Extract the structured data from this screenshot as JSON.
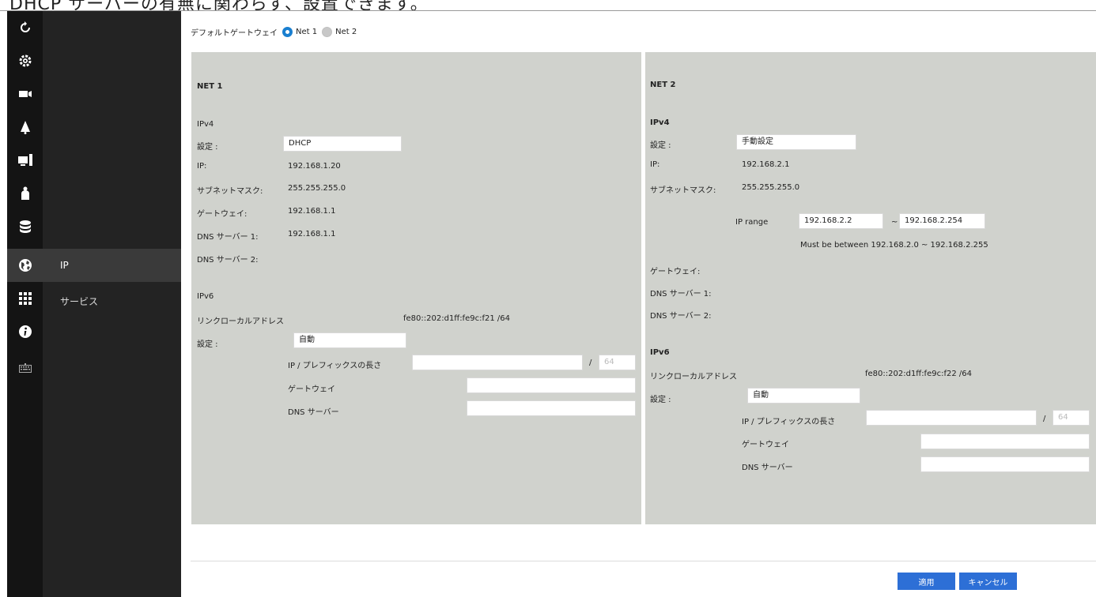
{
  "top_caption": "DHCP サーバーの有無に関わらず、設置できます。",
  "sidebar": {
    "icons": [
      "refresh-icon",
      "gear-icon",
      "camera-icon",
      "alarm-bell-icon",
      "display-icon",
      "person-icon",
      "database-icon",
      "globe-icon",
      "grid-icon",
      "info-icon",
      "keyboard-icon"
    ],
    "items": [
      {
        "label": "IP",
        "active": true
      },
      {
        "label": "サービス",
        "active": false
      }
    ]
  },
  "default_gateway": {
    "label": "デフォルトゲートウェイ",
    "options": [
      {
        "label": "Net 1",
        "selected": true
      },
      {
        "label": "Net 2",
        "selected": false
      }
    ]
  },
  "net1": {
    "title": "NET 1",
    "ipv4": {
      "heading": "IPv4",
      "setting_label": "設定 :",
      "setting_value": "DHCP",
      "ip_label": "IP:",
      "ip_value": "192.168.1.20",
      "subnet_label": "サブネットマスク:",
      "subnet_value": "255.255.255.0",
      "gateway_label": "ゲートウェイ:",
      "gateway_value": "192.168.1.1",
      "dns1_label": "DNS サーバー 1:",
      "dns1_value": "192.168.1.1",
      "dns2_label": "DNS サーバー 2:"
    },
    "ipv6": {
      "heading": "IPv6",
      "link_local_label": "リンクローカルアドレス",
      "link_local_value": "fe80::202:d1ff:fe9c:f21  /64",
      "setting_label": "設定 :",
      "setting_value": "自動",
      "prefix_label": "IP / プレフィックスの長さ",
      "prefix_sep": "/",
      "prefix_placeholder": "64",
      "gateway_label": "ゲートウェイ",
      "dns_label": "DNS サーバー"
    }
  },
  "net2": {
    "title": "NET 2",
    "ipv4": {
      "heading": "IPv4",
      "setting_label": "設定 :",
      "setting_value": "手動設定",
      "ip_label": "IP:",
      "ip_value": "192.168.2.1",
      "subnet_label": "サブネットマスク:",
      "subnet_value": "255.255.255.0",
      "range_label": "IP range",
      "range_start": "192.168.2.2",
      "range_sep": "~",
      "range_end": "192.168.2.254",
      "range_note": "Must be between 192.168.2.0 ~ 192.168.2.255",
      "gateway_label": "ゲートウェイ:",
      "dns1_label": "DNS サーバー 1:",
      "dns2_label": "DNS サーバー 2:"
    },
    "ipv6": {
      "heading": "IPv6",
      "link_local_label": "リンクローカルアドレス",
      "link_local_value": "fe80::202:d1ff:fe9c:f22  /64",
      "setting_label": "設定 :",
      "setting_value": "自動",
      "prefix_label": "IP / プレフィックスの長さ",
      "prefix_sep": "/",
      "prefix_placeholder": "64",
      "gateway_label": "ゲートウェイ",
      "dns_label": "DNS サーバー"
    }
  },
  "buttons": {
    "apply": "適用",
    "cancel": "キャンセル"
  },
  "colors": {
    "accent": "#2d6fd6",
    "panel": "#d0d2cd",
    "sidebar": "#141414",
    "nav": "#232323"
  }
}
